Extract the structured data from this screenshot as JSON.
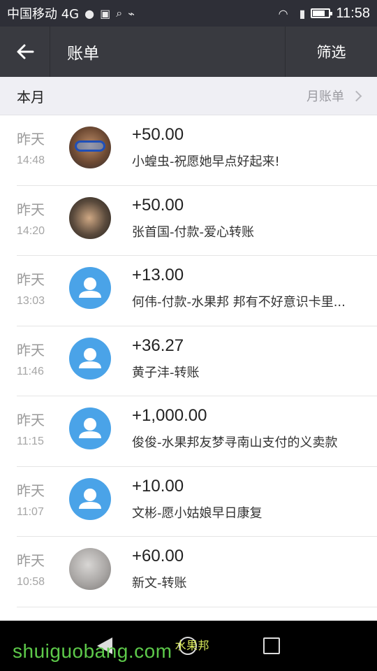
{
  "status_bar": {
    "carrier": "中国移动 4G",
    "network": "4G",
    "time": "11:58"
  },
  "title_bar": {
    "back_icon": "back-arrow-icon",
    "title": "账单",
    "filter_label": "筛选"
  },
  "section": {
    "title": "本月",
    "monthly_bill_label": "月账单"
  },
  "transactions": [
    {
      "day": "昨天",
      "time": "14:48",
      "amount": "+50.00",
      "desc": "小蝗虫-祝愿她早点好起来!",
      "avatar": "photo1"
    },
    {
      "day": "昨天",
      "time": "14:20",
      "amount": "+50.00",
      "desc": "张首国-付款-爱心转账",
      "avatar": "photo2"
    },
    {
      "day": "昨天",
      "time": "13:03",
      "amount": "+13.00",
      "desc": "何伟-付款-水果邦  邦有不好意识卡里...",
      "avatar": "default"
    },
    {
      "day": "昨天",
      "time": "11:46",
      "amount": "+36.27",
      "desc": "黄子沣-转账",
      "avatar": "default"
    },
    {
      "day": "昨天",
      "time": "11:15",
      "amount": "+1,000.00",
      "desc": "俊俊-水果邦友梦寻南山支付的义卖款",
      "avatar": "default"
    },
    {
      "day": "昨天",
      "time": "11:07",
      "amount": "+10.00",
      "desc": "文彬-愿小姑娘早日康复",
      "avatar": "default"
    },
    {
      "day": "昨天",
      "time": "10:58",
      "amount": "+60.00",
      "desc": "新文-转账",
      "avatar": "photo3"
    }
  ],
  "watermark": {
    "text": "shuiguobang.com",
    "cn": "水果邦"
  }
}
